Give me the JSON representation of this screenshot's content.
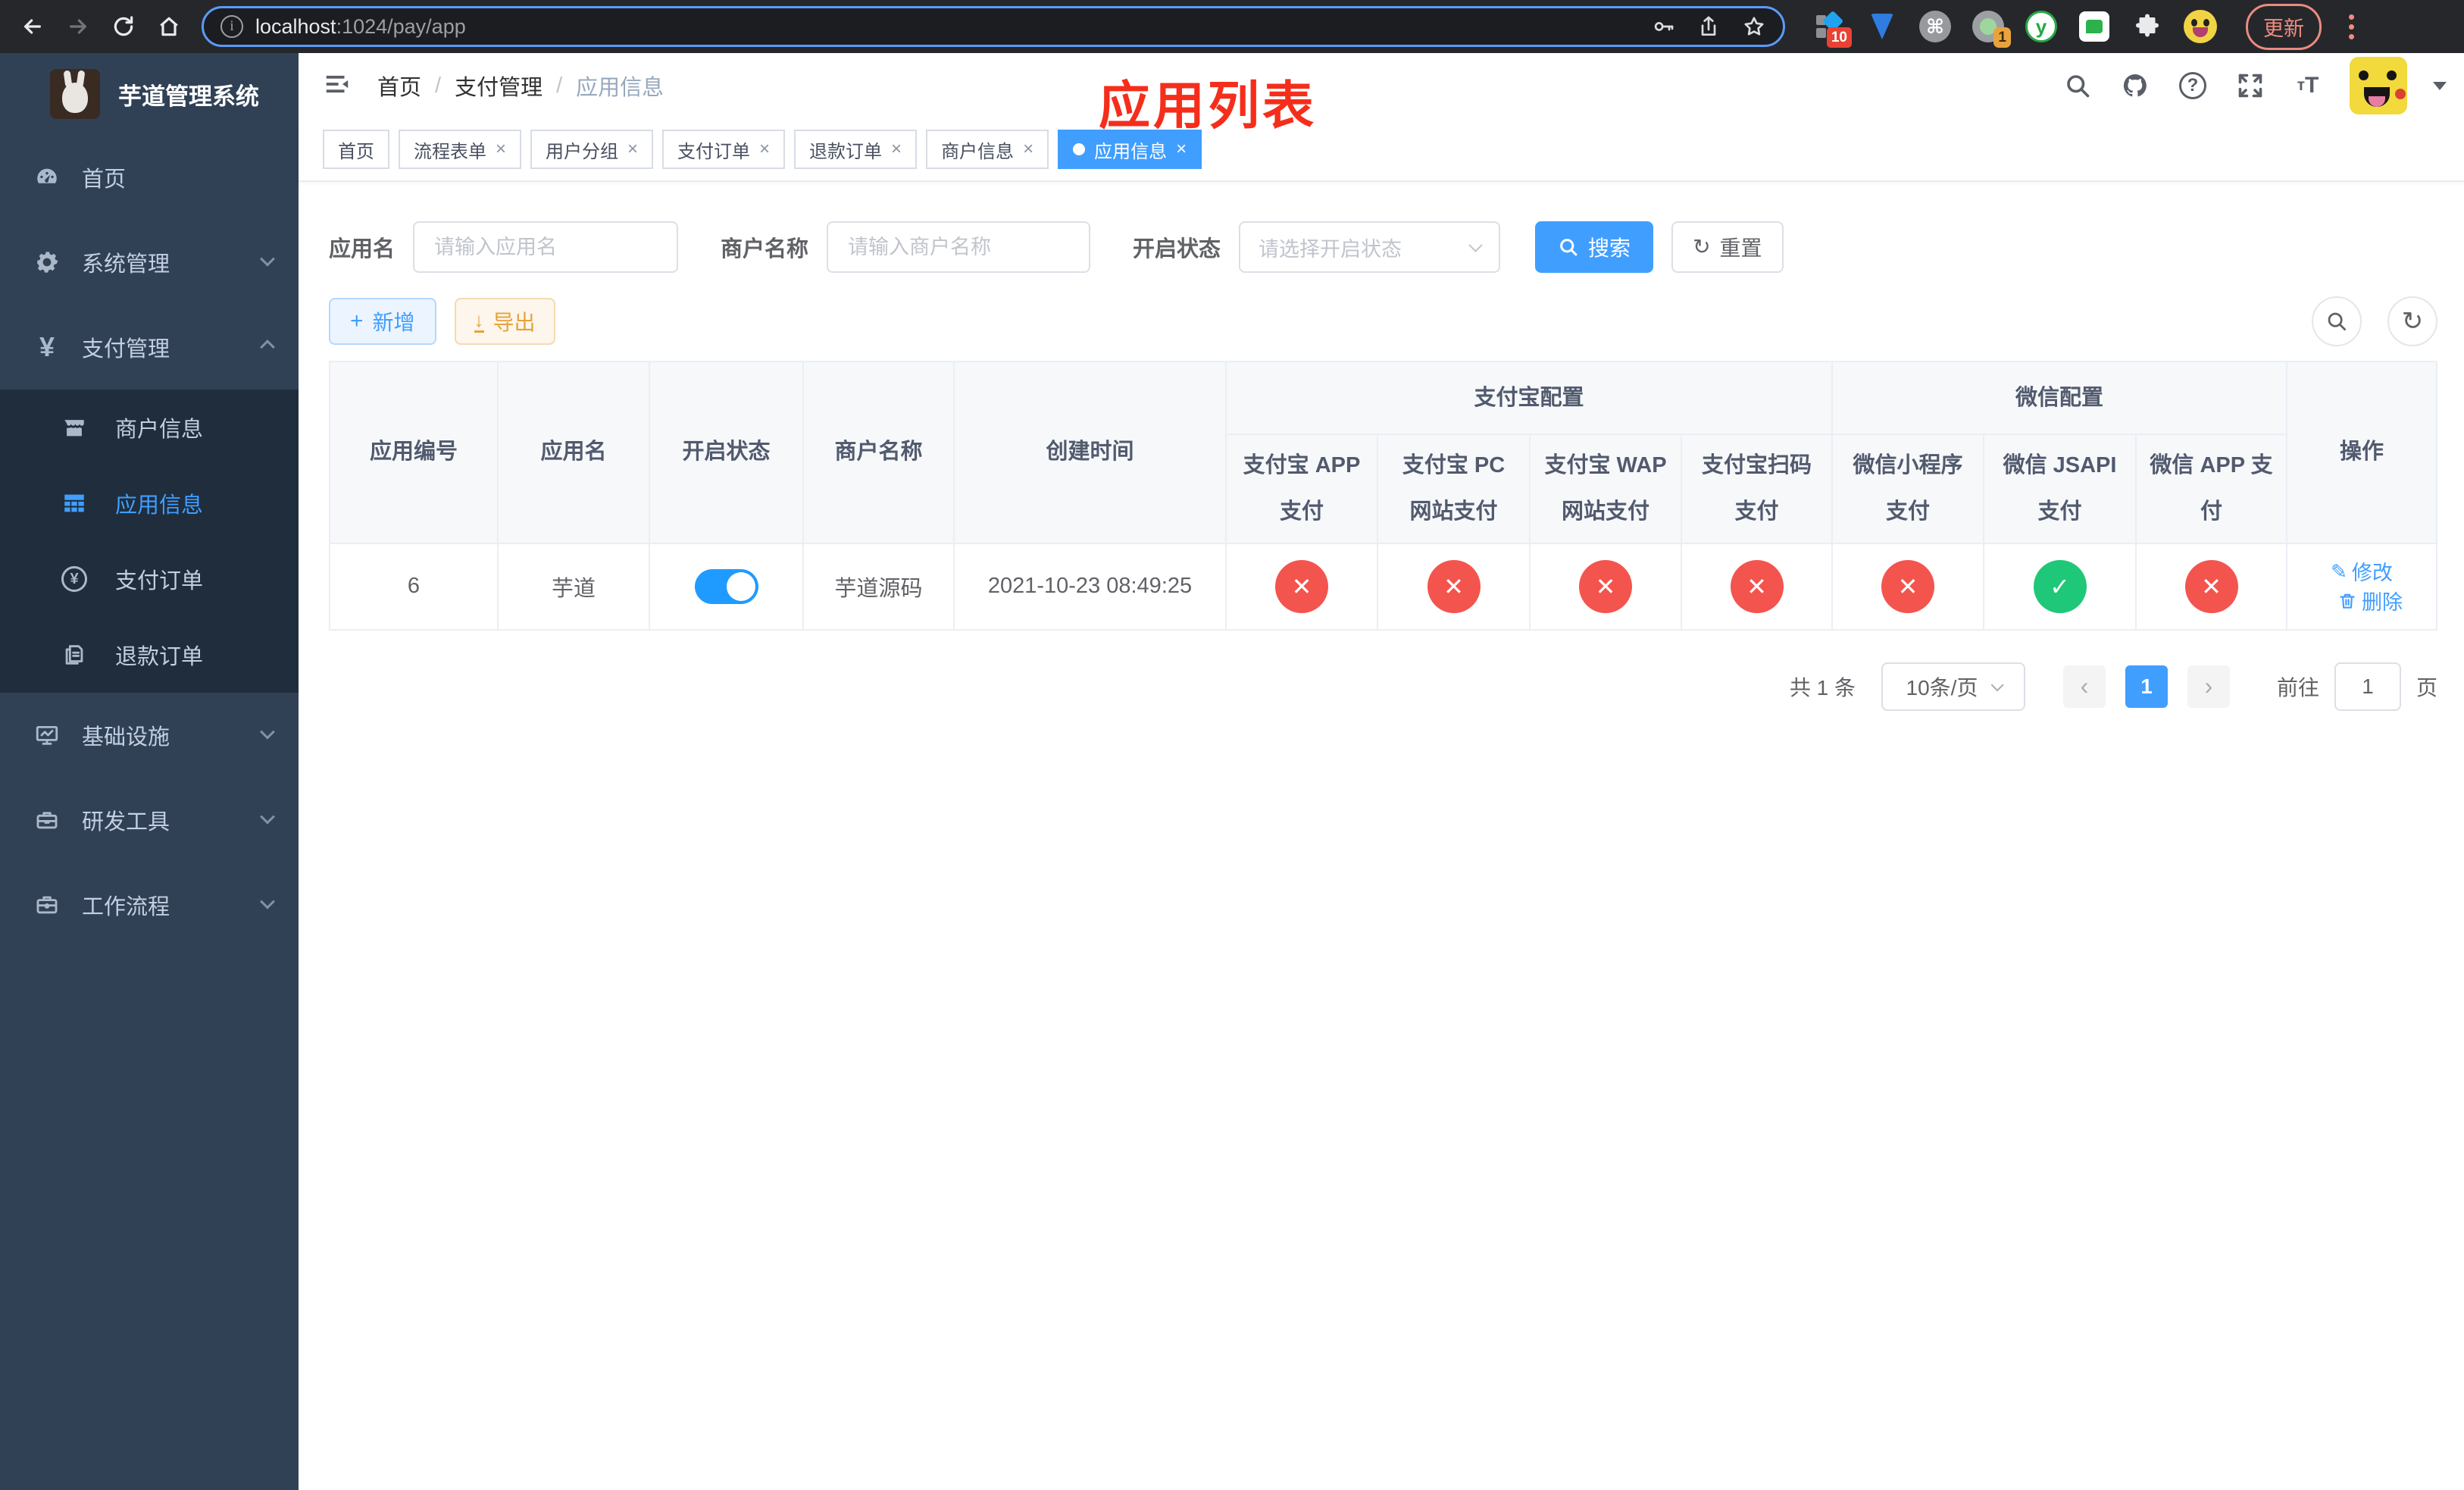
{
  "colors": {
    "primary": "#409eff",
    "success": "#1ec878",
    "danger": "#f4544e",
    "warning": "#e6a23c",
    "sidebar_bg": "#304156",
    "submenu_bg": "#1f2d3d",
    "annotation_red": "#f52e1c"
  },
  "icons": {
    "check": "✓",
    "cross": "✕",
    "close": "×",
    "plus": "+",
    "download": "↓",
    "refresh": "↻",
    "prev": "‹",
    "next": "›",
    "pencil": "✎"
  },
  "browser": {
    "url": {
      "host": "localhost",
      "rest": ":1024/pay/app"
    },
    "extension_badge_collection": "10",
    "extension_badge_dot": "1",
    "update_label": "更新"
  },
  "sidebar": {
    "title": "芋道管理系统",
    "items": [
      {
        "label": "首页",
        "icon": "dashboard-icon",
        "chevron": null,
        "active": false
      },
      {
        "label": "系统管理",
        "icon": "gear-icon",
        "chevron": "down",
        "active": false
      },
      {
        "label": "支付管理",
        "icon": "yen-icon",
        "chevron": "up",
        "active": true
      }
    ],
    "submenu": [
      {
        "label": "商户信息",
        "icon": "shop-icon",
        "active": false
      },
      {
        "label": "应用信息",
        "icon": "grid-icon",
        "active": true
      },
      {
        "label": "支付订单",
        "icon": "yen-circle-icon",
        "active": false
      },
      {
        "label": "退款订单",
        "icon": "document-icon",
        "active": false
      }
    ],
    "items_bottom": [
      {
        "label": "基础设施",
        "icon": "monitor-icon",
        "chevron": "down",
        "active": false
      },
      {
        "label": "研发工具",
        "icon": "toolbox-icon",
        "chevron": "down",
        "active": false
      },
      {
        "label": "工作流程",
        "icon": "briefcase-icon",
        "chevron": "down",
        "active": false
      }
    ]
  },
  "header": {
    "breadcrumb": [
      {
        "label": "首页"
      },
      {
        "label": "支付管理"
      },
      {
        "label": "应用信息"
      }
    ],
    "separator": "/",
    "overlay_title": "应用列表"
  },
  "tags": [
    {
      "label": "首页",
      "closable": false,
      "active": false
    },
    {
      "label": "流程表单",
      "closable": true,
      "active": false
    },
    {
      "label": "用户分组",
      "closable": true,
      "active": false
    },
    {
      "label": "支付订单",
      "closable": true,
      "active": false
    },
    {
      "label": "退款订单",
      "closable": true,
      "active": false
    },
    {
      "label": "商户信息",
      "closable": true,
      "active": false
    },
    {
      "label": "应用信息",
      "closable": true,
      "active": true
    }
  ],
  "filters": {
    "app_name": {
      "label": "应用名",
      "placeholder": "请输入应用名",
      "value": ""
    },
    "merchant_name": {
      "label": "商户名称",
      "placeholder": "请输入商户名称",
      "value": ""
    },
    "status": {
      "label": "开启状态",
      "placeholder": "请选择开启状态",
      "value": ""
    },
    "search_label": "搜索",
    "reset_label": "重置"
  },
  "toolbar": {
    "add_label": "新增",
    "export_label": "导出"
  },
  "table": {
    "columns": {
      "app_id": "应用编号",
      "app_name": "应用名",
      "status": "开启状态",
      "merchant": "商户名称",
      "created_at": "创建时间",
      "actions": "操作"
    },
    "groups": {
      "alipay": "支付宝配置",
      "wechat": "微信配置"
    },
    "channel_columns": [
      "支付宝 APP 支付",
      "支付宝 PC 网站支付",
      "支付宝 WAP 网站支付",
      "支付宝扫码支付",
      "微信小程序支付",
      "微信 JSAPI 支付",
      "微信 APP 支付"
    ],
    "rows": [
      {
        "app_id": "6",
        "app_name": "芋道",
        "enabled": true,
        "merchant": "芋道源码",
        "created_at": "2021-10-23 08:49:25",
        "channels": [
          false,
          false,
          false,
          false,
          false,
          true,
          false
        ],
        "edit_label": "修改",
        "delete_label": "删除"
      }
    ]
  },
  "pagination": {
    "total": "共 1 条",
    "page_size": "10条/页",
    "current_page": "1",
    "goto_label": "前往",
    "goto_value": "1",
    "goto_unit": "页"
  }
}
